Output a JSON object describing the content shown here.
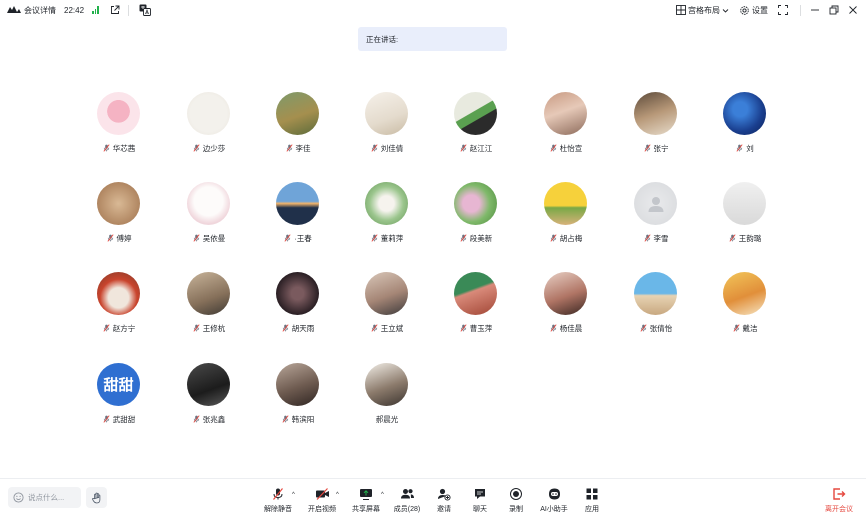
{
  "topbar": {
    "title": "会议详情",
    "time": "22:42",
    "layout_label": "宫格布局",
    "settings_label": "设置"
  },
  "speaking": {
    "label": "正在讲话:"
  },
  "participants": [
    {
      "name": "华芯茜",
      "muted": true
    },
    {
      "name": "边少莎",
      "muted": true
    },
    {
      "name": "李佳",
      "muted": true
    },
    {
      "name": "刘佳倩",
      "muted": true
    },
    {
      "name": "赵江江",
      "muted": true
    },
    {
      "name": "杜怡宣",
      "muted": true
    },
    {
      "name": "张宁",
      "muted": true
    },
    {
      "name": "刘",
      "muted": true
    },
    {
      "name": "傅婷",
      "muted": true
    },
    {
      "name": "吴依曼",
      "muted": true
    },
    {
      "name": "·王春",
      "muted": true
    },
    {
      "name": "董莉萍",
      "muted": true
    },
    {
      "name": "段美新",
      "muted": true
    },
    {
      "name": "胡占梅",
      "muted": true
    },
    {
      "name": "李雪",
      "muted": true
    },
    {
      "name": "王韵璐",
      "muted": true
    },
    {
      "name": "赵方宁",
      "muted": true
    },
    {
      "name": "王修杭",
      "muted": true
    },
    {
      "name": "胡天雨",
      "muted": true
    },
    {
      "name": "王立斌",
      "muted": true
    },
    {
      "name": "曹玉萍",
      "muted": true
    },
    {
      "name": "杨佳晨",
      "muted": true
    },
    {
      "name": "张倩怡",
      "muted": true
    },
    {
      "name": "戴洁",
      "muted": true
    },
    {
      "name": "武甜甜",
      "muted": true,
      "avatar_text": "甜甜"
    },
    {
      "name": "张兆鑫",
      "muted": true
    },
    {
      "name": "韩滨阳",
      "muted": true
    },
    {
      "name": "郝晨光",
      "muted": false
    }
  ],
  "bottombar": {
    "chat_placeholder": "说点什么...",
    "unmute": "解除静音",
    "start_video": "开启视频",
    "share_screen": "共享屏幕",
    "members": "成员(28)",
    "invite": "邀请",
    "chat": "聊天",
    "record": "录制",
    "ai_assistant": "AI小助手",
    "apps": "应用",
    "leave": "离开会议"
  },
  "colors": {
    "accent": "#3370ff",
    "leave": "#e5483f",
    "muted_mic": "#e5483f",
    "signal": "#22b14c"
  }
}
